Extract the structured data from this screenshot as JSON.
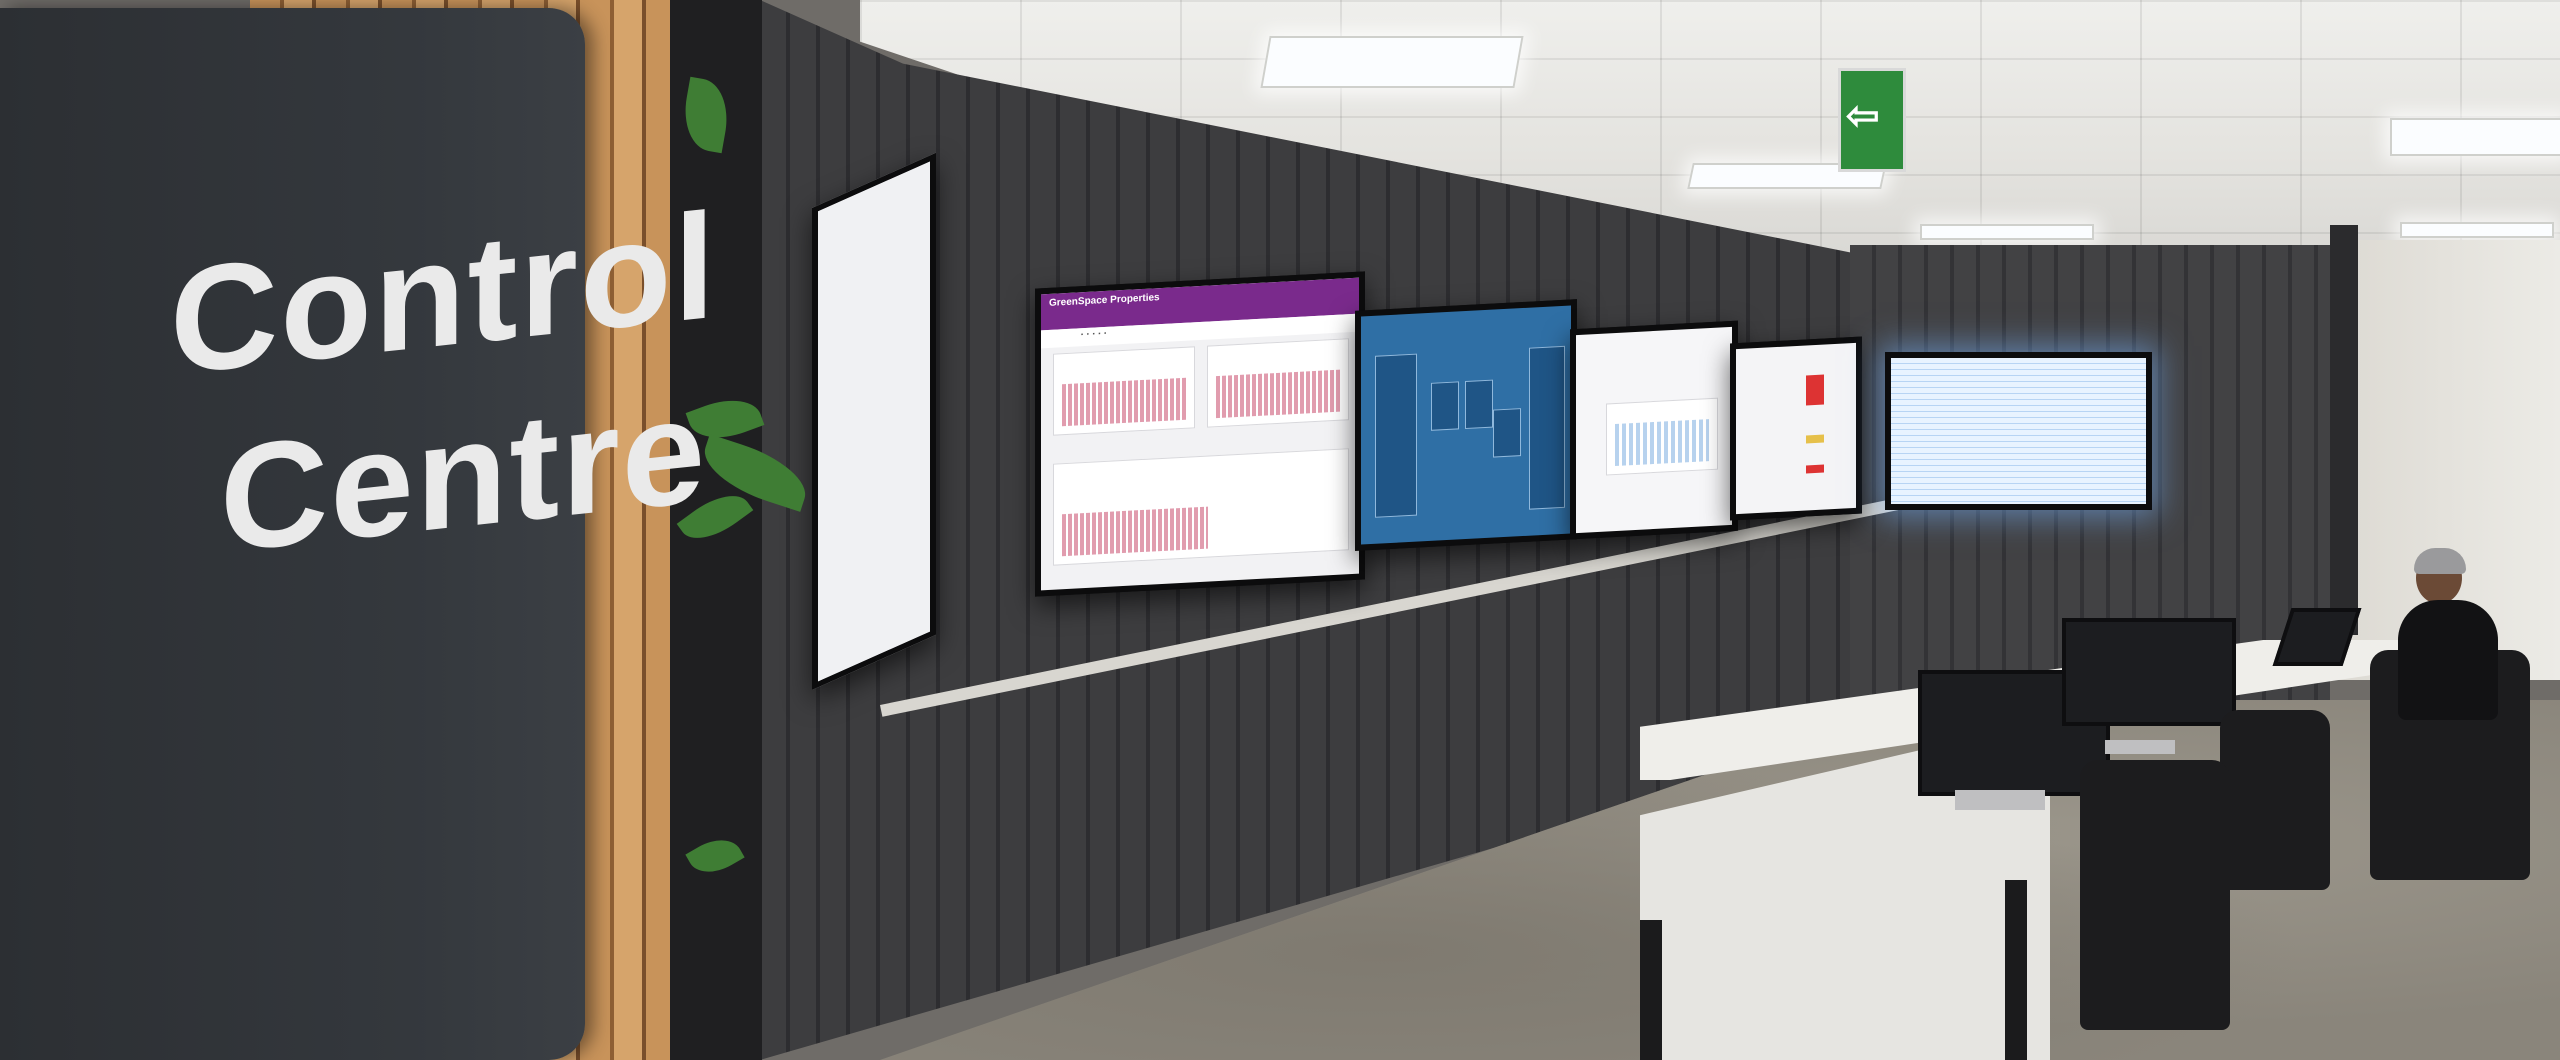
{
  "sign": {
    "line1": "Control",
    "line2": "Centre"
  },
  "screens": {
    "purple_dashboard_title": "GreenSpace Properties"
  }
}
